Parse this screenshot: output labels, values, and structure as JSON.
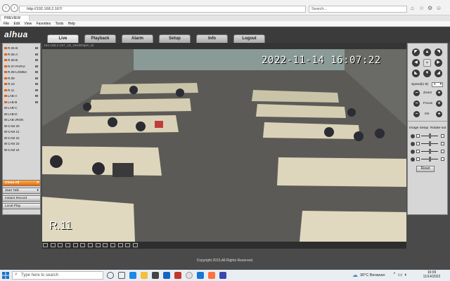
{
  "browser": {
    "url": "http://192.168.2.167/",
    "search_placeholder": "Search...",
    "tab_title": "PREVIEW",
    "menu": [
      "File",
      "Edit",
      "View",
      "Favorites",
      "Tools",
      "Help"
    ]
  },
  "app": {
    "logo": "alhua",
    "tabs": [
      "Live",
      "Playback",
      "Alarm",
      "Setup",
      "Info",
      "Logout"
    ],
    "active_tab": "Live"
  },
  "cameras": [
    {
      "label": "R.05-B",
      "flag": "M"
    },
    {
      "label": "R.06-A",
      "flag": "M"
    },
    {
      "label": "R.06-B",
      "flag": "M"
    },
    {
      "label": "R.07-PAPUI",
      "flag": "M"
    },
    {
      "label": "R.08-LOMBA",
      "flag": "M"
    },
    {
      "label": "R.09",
      "flag": "M"
    },
    {
      "label": "R.10",
      "flag": "M"
    },
    {
      "label": "R.11",
      "flag": "M"
    },
    {
      "label": "LAB-A",
      "flag": "M"
    },
    {
      "label": "LAB-B",
      "flag": "M"
    },
    {
      "label": "LAB-C",
      "flag": ""
    },
    {
      "label": "LAB-D",
      "flag": ""
    },
    {
      "label": "LAB-JRSN",
      "flag": ""
    },
    {
      "label": "CAM 20",
      "flag": ""
    },
    {
      "label": "CAM 21",
      "flag": ""
    },
    {
      "label": "CAM 22",
      "flag": ""
    },
    {
      "label": "CAM 23",
      "flag": ""
    },
    {
      "label": "CAM 24",
      "flag": ""
    }
  ],
  "controls": {
    "close_all": "Close All",
    "start_talk": "Start Talk",
    "instant_record": "Instant Record",
    "local_play": "Local Play"
  },
  "video": {
    "header": "192.168.2.167_16_1B1903pm_M",
    "timestamp": "2022-11-14 16:07:22",
    "channel_name": "R.11"
  },
  "ptz": {
    "speed_label": "Speed(1-8)",
    "speed_value": "5",
    "zoom_label": "Zoom",
    "focus_label": "Focus",
    "iris_label": "Iris",
    "minus": "−",
    "plus": "+",
    "image_setup_label": "Image Setup",
    "rotate_label": "Rotate-out",
    "reset_label": "Reset"
  },
  "footer": {
    "copyright": "Copyright 2015,All Rights Reserved."
  },
  "taskbar": {
    "search_placeholder": "Type here to search",
    "weather": "30°C  Berawan",
    "time": "16:09",
    "date": "11/14/2022"
  },
  "colors": {
    "accent_orange": "#e8650f",
    "panel_bg": "#d6d6d6",
    "header_bg": "#3b3b3b"
  }
}
